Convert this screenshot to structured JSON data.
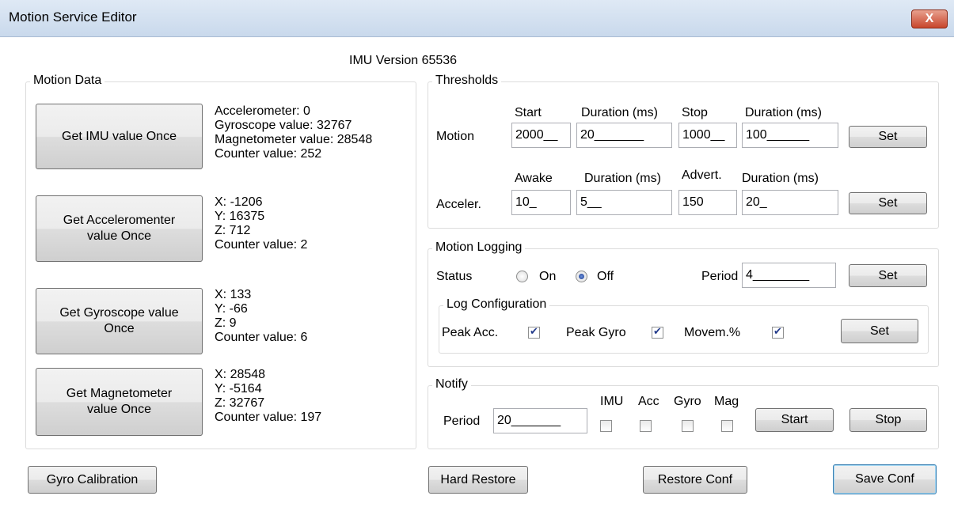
{
  "window": {
    "title": "Motion Service Editor",
    "close_label": "X"
  },
  "imu_version": "IMU Version 65536",
  "motion_data": {
    "legend": "Motion Data",
    "imu": {
      "button": "Get IMU value Once",
      "lines": [
        "Accelerometer: 0",
        "Gyroscope value: 32767",
        "Magnetometer value: 28548",
        "Counter value: 252"
      ]
    },
    "accelerometer": {
      "button_line1": "Get Acceleromenter",
      "button_line2": "value Once",
      "lines": [
        "X: -1206",
        "Y: 16375",
        "Z: 712",
        "Counter value: 2"
      ]
    },
    "gyroscope": {
      "button_line1": "Get Gyroscope value",
      "button_line2": "Once",
      "lines": [
        "X: 133",
        "Y: -66",
        "Z: 9",
        "Counter value: 6"
      ]
    },
    "magnetometer": {
      "button_line1": "Get Magnetometer",
      "button_line2": "value Once",
      "lines": [
        "X: 28548",
        "Y: -5164",
        "Z: 32767",
        "Counter value: 197"
      ]
    }
  },
  "thresholds": {
    "legend": "Thresholds",
    "motion": {
      "label": "Motion",
      "headers": [
        "Start",
        "Duration (ms)",
        "Stop",
        "Duration (ms)"
      ],
      "values": [
        "2000__",
        "20_______",
        "1000__",
        "100______"
      ],
      "set_label": "Set"
    },
    "acceler": {
      "label": "Acceler.",
      "headers": [
        "Awake",
        "Duration (ms)",
        "Advert.",
        "Duration (ms)"
      ],
      "values": [
        "10_",
        "5__",
        "150",
        "20_"
      ],
      "set_label": "Set"
    }
  },
  "motion_logging": {
    "legend": "Motion Logging",
    "status_label": "Status",
    "on_label": "On",
    "off_label": "Off",
    "selected": "Off",
    "period_label": "Period",
    "period_value": "4________",
    "set_label": "Set",
    "log_config": {
      "legend": "Log Configuration",
      "peak_acc_label": "Peak Acc.",
      "peak_gyro_label": "Peak Gyro",
      "movem_label": "Movem.%",
      "peak_acc_checked": true,
      "peak_gyro_checked": true,
      "movem_checked": true,
      "set_label": "Set"
    }
  },
  "notify": {
    "legend": "Notify",
    "period_label": "Period",
    "period_value": "20_______",
    "imu_label": "IMU",
    "acc_label": "Acc",
    "gyro_label": "Gyro",
    "mag_label": "Mag",
    "start_label": "Start",
    "stop_label": "Stop"
  },
  "bottom": {
    "gyro_calibration": "Gyro Calibration",
    "hard_restore": "Hard Restore",
    "restore_conf": "Restore Conf",
    "save_conf": "Save Conf"
  }
}
